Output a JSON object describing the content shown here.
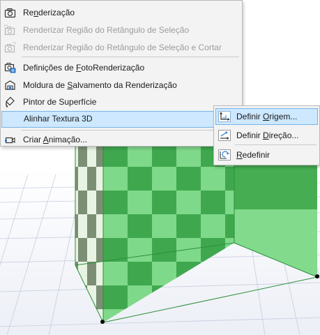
{
  "menu": {
    "items": [
      {
        "pre": "Re",
        "key": "n",
        "post": "derização",
        "icon": "render-camera-icon",
        "disabled": false
      },
      {
        "pre": "Renderizar Região do Retângulo de Seleção",
        "key": "",
        "post": "",
        "icon": "render-region-icon",
        "disabled": true
      },
      {
        "pre": "Renderizar Região do Retângulo de Seleção e Cortar",
        "key": "",
        "post": "",
        "icon": "render-region-crop-icon",
        "disabled": true
      },
      {
        "pre": "Definições de ",
        "key": "F",
        "post": "otoRenderização",
        "icon": "photorender-settings-icon",
        "disabled": false
      },
      {
        "pre": "Moldura de ",
        "key": "S",
        "post": "alvamento da Renderização",
        "icon": "render-save-frame-icon",
        "disabled": false
      },
      {
        "pre": "Pintor de Superfície",
        "key": "",
        "post": "",
        "icon": "surface-painter-icon",
        "disabled": false
      },
      {
        "pre": "Alinhar Textura 3D",
        "key": "",
        "post": "",
        "icon": "",
        "disabled": false
      },
      {
        "pre": "Criar ",
        "key": "A",
        "post": "nimação...",
        "icon": "create-animation-icon",
        "disabled": false
      }
    ]
  },
  "submenu": {
    "items": [
      {
        "pre": "Definir ",
        "key": "O",
        "post": "rigem...",
        "icon": "set-origin-icon"
      },
      {
        "pre": "Definir ",
        "key": "D",
        "post": "ireção...",
        "icon": "set-direction-icon"
      },
      {
        "pre": "",
        "key": "R",
        "post": "edefinir",
        "icon": "reset-texture-icon"
      }
    ]
  },
  "colors": {
    "highlight": "#cde8ff",
    "highlight_border": "#78b4e6",
    "checker_dark": "#3fa84e",
    "checker_light": "#7fd98a"
  }
}
